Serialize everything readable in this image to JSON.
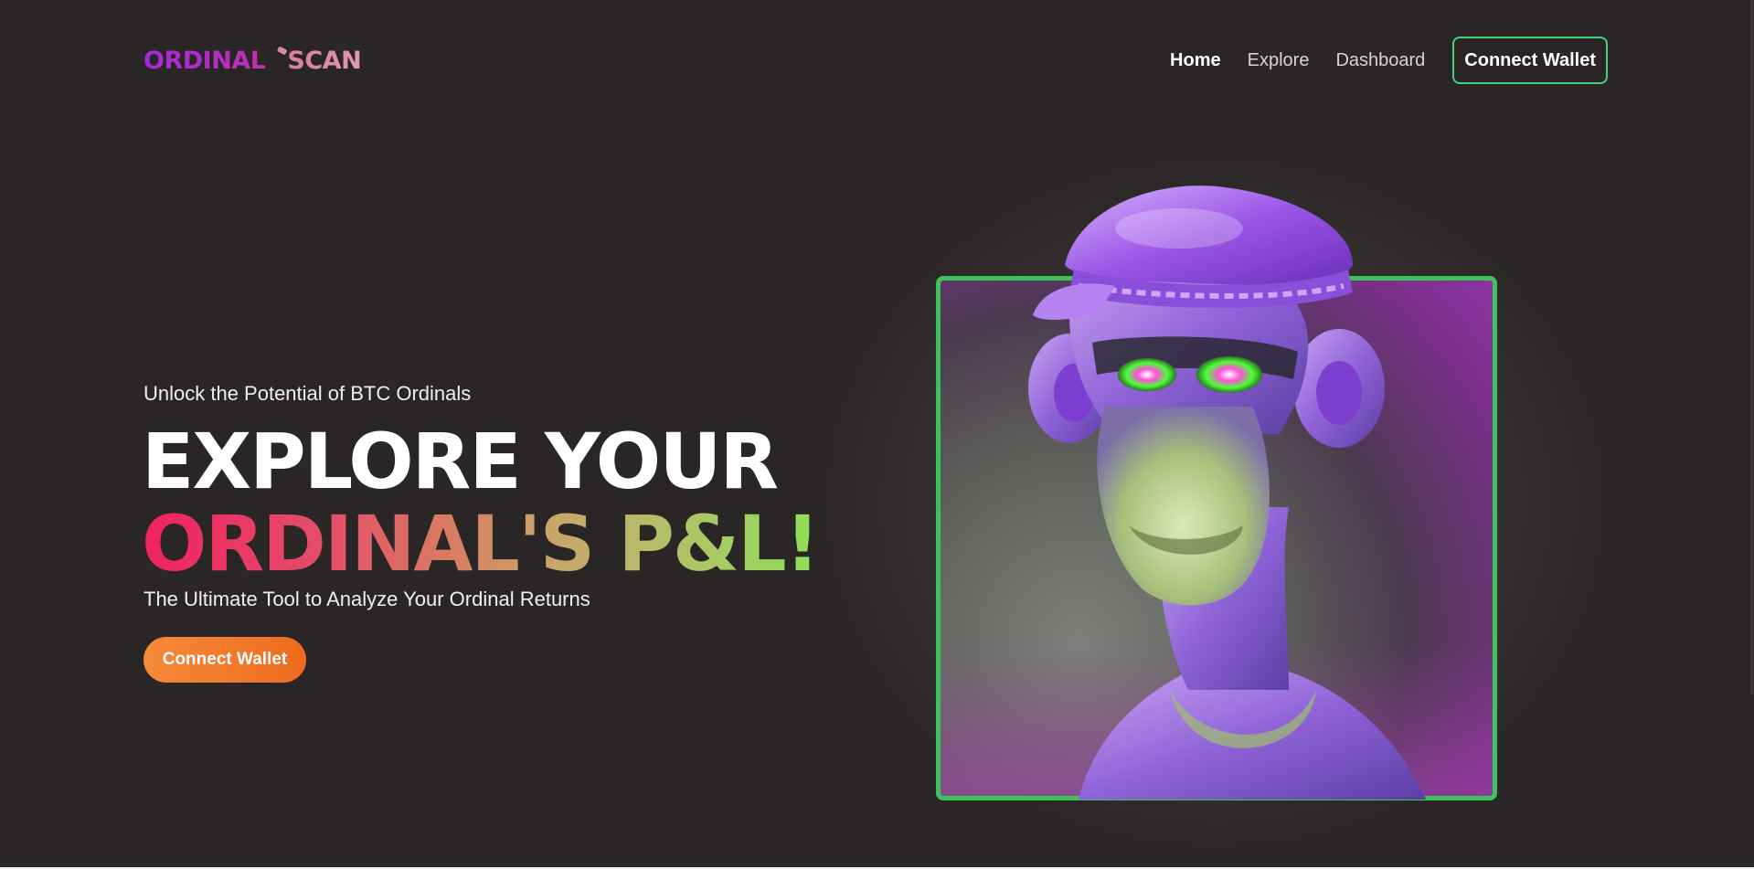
{
  "header": {
    "logo_part1": "ORDINAL",
    "logo_part2": "SCAN",
    "nav": [
      {
        "label": "Home",
        "active": true
      },
      {
        "label": "Explore",
        "active": false
      },
      {
        "label": "Dashboard",
        "active": false
      }
    ],
    "connect_button": "Connect Wallet"
  },
  "hero": {
    "eyebrow": "Unlock the Potential of BTC Ordinals",
    "headline_line1": "EXPLORE YOUR",
    "headline_line2": "ORDINAL'S P&L!",
    "subline": "The Ultimate Tool to Analyze Your Ordinal Returns",
    "cta_button": "Connect Wallet"
  },
  "colors": {
    "background": "#2a2626",
    "accent_green": "#45d07a",
    "cta_orange": "#f07a2a",
    "logo_purple": "#a12bd9"
  }
}
